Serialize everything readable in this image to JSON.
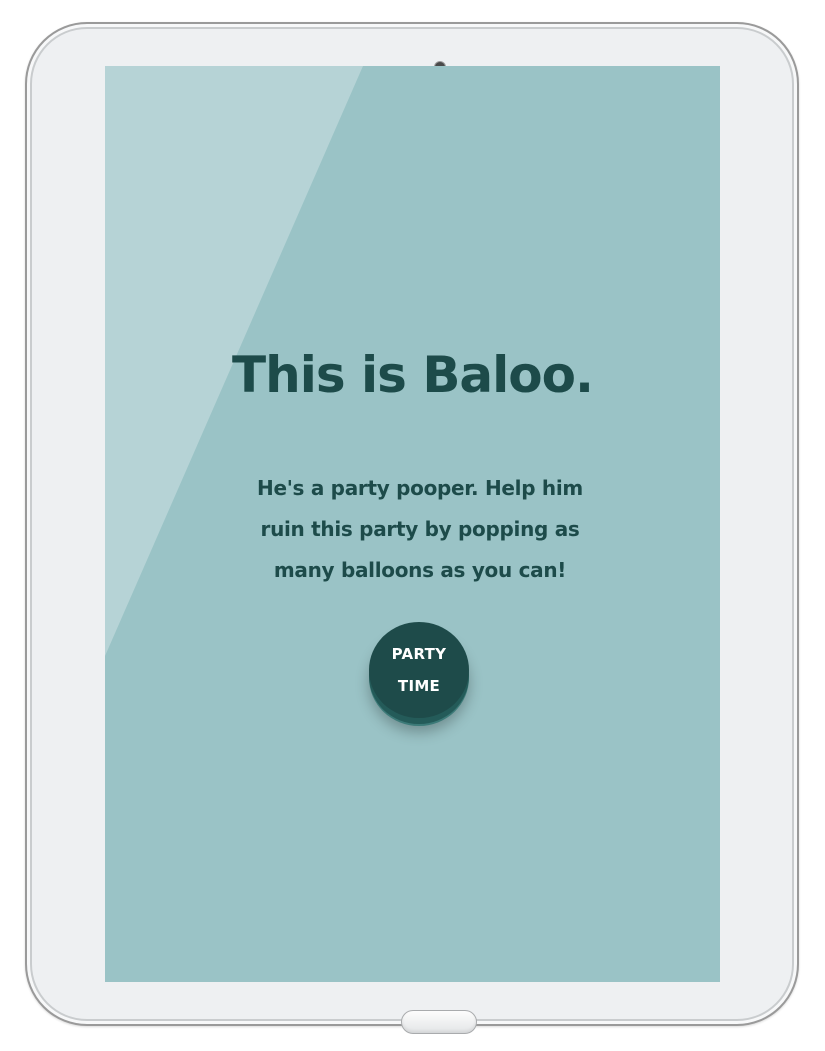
{
  "screen": {
    "headline": "This is Baloo.",
    "description": "He's a party pooper. Help him ruin this party by popping as many balloons as you can!",
    "start_button": {
      "line1": "PARTY",
      "line2": "TIME"
    }
  },
  "colors": {
    "screen_background": "#9ac3c6",
    "text": "#1d4b4a",
    "button": "#1e4b4a",
    "button_text": "#ffffff",
    "device_frame": "#eef0f2"
  }
}
